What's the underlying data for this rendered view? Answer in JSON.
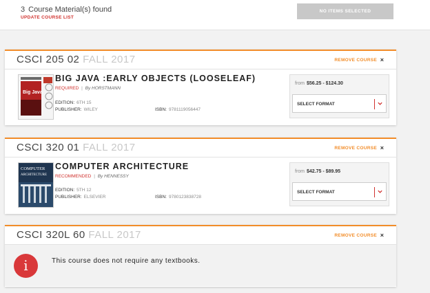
{
  "header": {
    "count": "3",
    "found_text": "Course Material(s) found",
    "update_link": "UPDATE COURSE LIST",
    "no_items_button": "NO ITEMS SELECTED"
  },
  "courses": [
    {
      "code": "CSCI 205",
      "section": "02",
      "term": "FALL 2017",
      "remove_label": "REMOVE COURSE",
      "remove_x": "×",
      "book": {
        "title": "BIG JAVA :EARLY OBJECTS (LOOSELEAF)",
        "status": "REQUIRED",
        "separator": "|",
        "author": "By HORSTMANN",
        "edition_label": "EDITION:",
        "edition": "6TH 15",
        "publisher_label": "PUBLISHER:",
        "publisher": "WILEY",
        "isbn_label": "ISBN:",
        "isbn": "9781119056447",
        "cover_text": "Big Java",
        "price_prefix": "from",
        "price_range": "$56.25 - $124.30",
        "format_label": "SELECT FORMAT"
      }
    },
    {
      "code": "CSCI 320",
      "section": "01",
      "term": "FALL 2017",
      "remove_label": "REMOVE COURSE",
      "remove_x": "×",
      "book": {
        "title": "COMPUTER ARCHITECTURE",
        "status": "RECOMMENDED",
        "separator": "|",
        "author": "By HENNESSY",
        "edition_label": "EDITION:",
        "edition": "5TH 12",
        "publisher_label": "PUBLISHER:",
        "publisher": "ELSEVIER",
        "isbn_label": "ISBN:",
        "isbn": "9780123838728",
        "cover_text_1": "COMPUTER",
        "cover_text_2": "ARCHITECTURE",
        "price_prefix": "from",
        "price_range": "$42.75 - $89.95",
        "format_label": "SELECT FORMAT"
      }
    },
    {
      "code": "CSCI 320L",
      "section": "60",
      "term": "FALL 2017",
      "remove_label": "REMOVE COURSE",
      "remove_x": "×",
      "notice_icon": "i",
      "notice": "This course does not require any textbooks."
    }
  ],
  "colors": {
    "accent_orange": "#f28c28",
    "alert_red": "#d0312d",
    "disabled_gray": "#c8c8c8"
  },
  "icons": [
    "info-icon",
    "chevron-down-icon",
    "close-icon"
  ]
}
